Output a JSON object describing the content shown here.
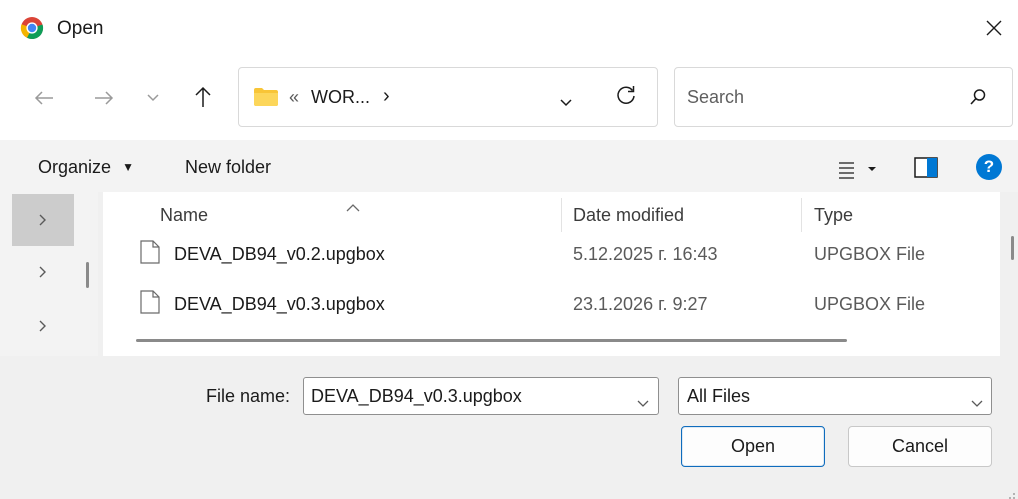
{
  "window": {
    "title": "Open",
    "icon": "chrome-icon"
  },
  "nav": {
    "back_icon": "arrow-left-icon",
    "forward_icon": "arrow-right-icon",
    "recent_icon": "chevron-down-icon",
    "up_icon": "arrow-up-icon",
    "address": {
      "prefix": "«",
      "folder": "WOR...",
      "separator": "›"
    },
    "refresh_icon": "refresh-icon",
    "search_placeholder": "Search"
  },
  "toolbar": {
    "organize_label": "Organize",
    "new_folder_label": "New folder",
    "view_icon": "list-view-icon",
    "preview_icon": "preview-pane-icon",
    "help_label": "?"
  },
  "columns": {
    "name": "Name",
    "date": "Date modified",
    "type": "Type"
  },
  "files": [
    {
      "name": "DEVA_DB94_v0.2.upgbox",
      "date": "5.12.2025 г. 16:43",
      "type": "UPGBOX File"
    },
    {
      "name": "DEVA_DB94_v0.3.upgbox",
      "date": "23.1.2026 г. 9:27",
      "type": "UPGBOX File"
    }
  ],
  "footer": {
    "file_name_label": "File name:",
    "file_name_value": "DEVA_DB94_v0.3.upgbox",
    "file_type_value": "All Files",
    "open_label": "Open",
    "cancel_label": "Cancel"
  },
  "colors": {
    "accent": "#0f6cbd",
    "help": "#0078d4",
    "folder": "#f8c537"
  }
}
